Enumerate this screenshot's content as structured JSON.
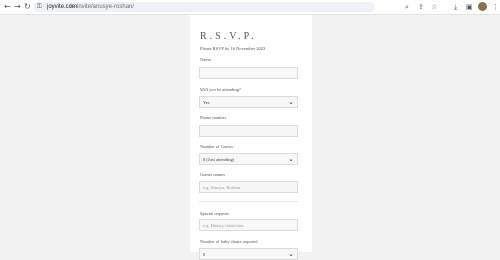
{
  "browser": {
    "url_host": "joyvite.com",
    "url_path": "/e-invite/anusye-roshan/"
  },
  "icons": {
    "back": "arrow-left-icon",
    "forward": "arrow-right-icon",
    "reload": "reload-icon",
    "lock": "lock-icon",
    "search": "search-icon",
    "share": "share-icon",
    "star": "star-icon",
    "download": "download-icon",
    "sidebar": "sidebar-icon",
    "avatar": "avatar-icon",
    "menu": "kebab-menu-icon",
    "chevron": "chevron-down-icon"
  },
  "rsvp": {
    "title": "R.S.V.P.",
    "deadline": "Please RSVP by 16 November 2023",
    "name_label": "Name",
    "name_value": "",
    "attending_label": "Will you be attending?",
    "attending_value": "Yes",
    "phone_label": "Phone number",
    "phone_value": "",
    "guests_label": "Number of Guests :",
    "guests_value": "0 (Just attending)",
    "guest_names_label": "Guests names",
    "guest_names_placeholder": "e.g. Anusya, Roshan",
    "special_label": "Special requests",
    "special_placeholder": "e.g. Dietary restriction",
    "baby_chairs_label": "Number of baby chairs required",
    "baby_chairs_value": "0"
  }
}
